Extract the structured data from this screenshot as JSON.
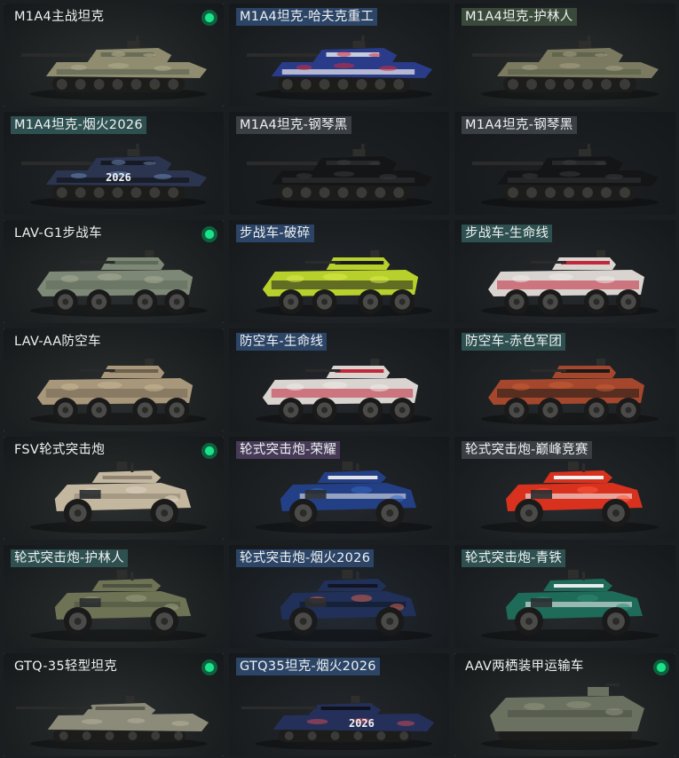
{
  "vehicles": [
    {
      "name": "M1A4主战坦克",
      "kind": "tank",
      "selected": true,
      "owned": true,
      "label_bg": "",
      "bg": "#2b2f2f",
      "body": "#8f8c70",
      "accent": "#5f6552",
      "camo": "#b3ae8f",
      "icon": "tank-icon"
    },
    {
      "name": "M1A4坦克-哈夫克重工",
      "kind": "tank",
      "selected": false,
      "owned": false,
      "label_bg": "#2c4566",
      "bg": "#24282c",
      "body": "#2a3b8a",
      "accent": "#f0f0f0",
      "camo": "#d22b3a",
      "icon": "tank-icon"
    },
    {
      "name": "M1A4坦克-护林人",
      "kind": "tank",
      "selected": false,
      "owned": false,
      "label_bg": "#3a4a3a",
      "bg": "#2a2e2d",
      "body": "#7b7a60",
      "accent": "#5b6348",
      "camo": "#a5a085",
      "icon": "tank-icon"
    },
    {
      "name": "M1A4坦克-烟火2026",
      "kind": "tank",
      "selected": false,
      "owned": false,
      "label_bg": "#2f5050",
      "bg": "#222629",
      "body": "#2c3550",
      "accent": "#111419",
      "camo": "#6a85b5",
      "icon": "tank-icon",
      "plate": "2026"
    },
    {
      "name": "M1A4坦克-钢琴黑",
      "kind": "tank",
      "selected": false,
      "owned": false,
      "label_bg": "#3a3f43",
      "bg": "#1e2124",
      "body": "#141517",
      "accent": "#2c2d30",
      "camo": "#3a3a3c",
      "icon": "tank-icon"
    },
    {
      "name": "M1A4坦克-钢琴黑",
      "kind": "tank",
      "selected": false,
      "owned": false,
      "label_bg": "#3a3f43",
      "bg": "#1e2124",
      "body": "#141517",
      "accent": "#2c2d30",
      "camo": "#3a3a3c",
      "icon": "tank-icon"
    },
    {
      "name": "LAV-G1步战车",
      "kind": "lav",
      "selected": true,
      "owned": true,
      "label_bg": "",
      "bg": "#2b2f2f",
      "body": "#7e8876",
      "accent": "#5e6a58",
      "camo": "#a6ad98",
      "icon": "ifv-icon"
    },
    {
      "name": "步战车-破碎",
      "kind": "lav",
      "selected": false,
      "owned": false,
      "label_bg": "#2c4566",
      "bg": "#24282c",
      "body": "#b8d02c",
      "accent": "#1a1c1c",
      "camo": "#d9ea4a",
      "icon": "ifv-icon"
    },
    {
      "name": "步战车-生命线",
      "kind": "lav",
      "selected": false,
      "owned": false,
      "label_bg": "#2f5050",
      "bg": "#262a2c",
      "body": "#d9d4d0",
      "accent": "#c2273a",
      "camo": "#ede9e6",
      "icon": "ifv-icon"
    },
    {
      "name": "LAV-AA防空车",
      "kind": "lav",
      "selected": true,
      "owned": false,
      "label_bg": "",
      "bg": "#2b2f2f",
      "body": "#a8977a",
      "accent": "#6d6250",
      "camo": "#c9b896",
      "icon": "aa-vehicle-icon"
    },
    {
      "name": "防空车-生命线",
      "kind": "lav",
      "selected": false,
      "owned": false,
      "label_bg": "#2c4566",
      "bg": "#24282c",
      "body": "#d9d4d0",
      "accent": "#c2273a",
      "camo": "#ede9e6",
      "icon": "aa-vehicle-icon"
    },
    {
      "name": "防空车-赤色军团",
      "kind": "lav",
      "selected": false,
      "owned": false,
      "label_bg": "#2f5050",
      "bg": "#262a2c",
      "body": "#a5472c",
      "accent": "#1a1918",
      "camo": "#c85c38",
      "icon": "aa-vehicle-icon"
    },
    {
      "name": "FSV轮式突击炮",
      "kind": "fsv",
      "selected": true,
      "owned": true,
      "label_bg": "",
      "bg": "#2b2f2f",
      "body": "#c4b7a0",
      "accent": "#8f8570",
      "camo": "#ddd3bf",
      "icon": "armored-car-icon"
    },
    {
      "name": "轮式突击炮-荣耀",
      "kind": "fsv",
      "selected": false,
      "owned": false,
      "label_bg": "#463a56",
      "bg": "#24282c",
      "body": "#233f86",
      "accent": "#dfe3e8",
      "camo": "#3a6ac0",
      "icon": "armored-car-icon"
    },
    {
      "name": "轮式突击炮-巅峰竞赛",
      "kind": "fsv",
      "selected": false,
      "owned": false,
      "label_bg": "#3a3f43",
      "bg": "#262a2c",
      "body": "#d8321f",
      "accent": "#f2f2f2",
      "camo": "#ff5a3a",
      "icon": "armored-car-icon"
    },
    {
      "name": "轮式突击炮-护林人",
      "kind": "fsv",
      "selected": false,
      "owned": false,
      "label_bg": "#2f5050",
      "bg": "#2b2f2f",
      "body": "#6e7355",
      "accent": "#4d5340",
      "camo": "#9a9d7f",
      "icon": "armored-car-icon"
    },
    {
      "name": "轮式突击炮-烟火2026",
      "kind": "fsv",
      "selected": false,
      "owned": false,
      "label_bg": "#2c4566",
      "bg": "#232a33",
      "body": "#203058",
      "accent": "#101521",
      "camo": "#d4604a",
      "icon": "armored-car-icon"
    },
    {
      "name": "轮式突击炮-青铁",
      "kind": "fsv",
      "selected": false,
      "owned": false,
      "label_bg": "#2f5050",
      "bg": "#262a2c",
      "body": "#1f6b5a",
      "accent": "#e9ecec",
      "camo": "#2e8a74",
      "icon": "armored-car-icon"
    },
    {
      "name": "GTQ-35轻型坦克",
      "kind": "light",
      "selected": true,
      "owned": true,
      "label_bg": "",
      "bg": "#2b2f2f",
      "body": "#8c8a78",
      "accent": "#5c5b4f",
      "camo": "#b4b19c",
      "icon": "light-tank-icon"
    },
    {
      "name": "GTQ35坦克-烟火2026",
      "kind": "light",
      "selected": false,
      "owned": false,
      "label_bg": "#2c4566",
      "bg": "#24282c",
      "body": "#25305a",
      "accent": "#0f1320",
      "camo": "#c94a55",
      "icon": "light-tank-icon",
      "plate": "2026"
    },
    {
      "name": "AAV两栖装甲运输车",
      "kind": "aav",
      "selected": true,
      "owned": true,
      "label_bg": "",
      "bg": "#2b2f2f",
      "body": "#6b7160",
      "accent": "#4b5044",
      "camo": "#8f947f",
      "icon": "amphibious-vehicle-icon"
    }
  ],
  "colors": {
    "page_bg": "#1b1e20",
    "owned_indicator": "#1ce38a",
    "selected_border": "#e6e8e9"
  }
}
